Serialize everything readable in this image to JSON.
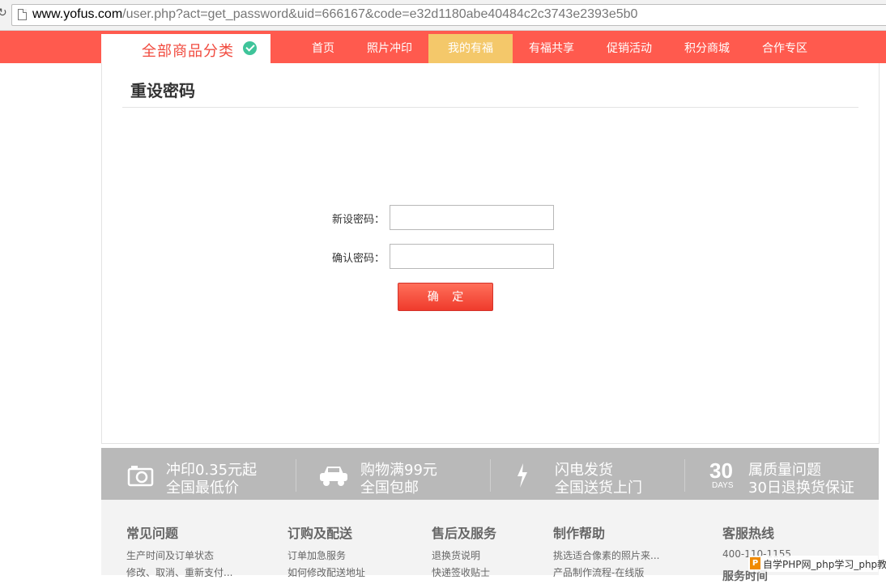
{
  "browser": {
    "url_host": "www.yofus.com",
    "url_path": "/user.php?act=get_password&uid=666167&code=e32d1180abe40484c2c3743e2393e5b0"
  },
  "nav": {
    "category_label": "全部商品分类",
    "items": [
      {
        "label": "首页"
      },
      {
        "label": "照片冲印"
      },
      {
        "label": "我的有福"
      },
      {
        "label": "有福共享"
      },
      {
        "label": "促销活动"
      },
      {
        "label": "积分商城"
      },
      {
        "label": "合作专区"
      }
    ],
    "active_index": 2
  },
  "page": {
    "title": "重设密码"
  },
  "form": {
    "new_password_label": "新设密码：",
    "confirm_password_label": "确认密码：",
    "new_password_value": "",
    "confirm_password_value": "",
    "submit_label": "确 定"
  },
  "features": [
    {
      "icon": "camera-icon",
      "line1": "冲印0.35元起",
      "line2": "全国最低价"
    },
    {
      "icon": "car-icon",
      "line1": "购物满99元",
      "line2": "全国包邮"
    },
    {
      "icon": "lightning-icon",
      "line1": "闪电发货",
      "line2": "全国送货上门"
    },
    {
      "icon": "30-days-icon",
      "days_number": "30",
      "days_text": "DAYS",
      "line1": "属质量问题",
      "line2": "30日退换货保证"
    }
  ],
  "footer": {
    "columns": [
      {
        "title": "常见问题",
        "links": [
          "生产时间及订单状态",
          "修改、取消、重新支付..."
        ]
      },
      {
        "title": "订购及配送",
        "links": [
          "订单加急服务",
          "如何修改配送地址"
        ]
      },
      {
        "title": "售后及服务",
        "links": [
          "退换货说明",
          "快递签收贴士"
        ]
      },
      {
        "title": "制作帮助",
        "links": [
          "挑选适合像素的照片来...",
          "产品制作流程-在线版"
        ]
      },
      {
        "title": "客服热线",
        "links": [
          "400-110-1155",
          "服务时间"
        ]
      }
    ]
  },
  "watermark": {
    "logo": "P",
    "text": "自学PHP网_php学习_php教"
  },
  "colors": {
    "nav_bg": "#ff5a4e",
    "nav_active": "#f4c86a",
    "button_red": "#ef3b2c",
    "check_green": "#3fc49a",
    "feature_strip": "#b9b9b9"
  }
}
